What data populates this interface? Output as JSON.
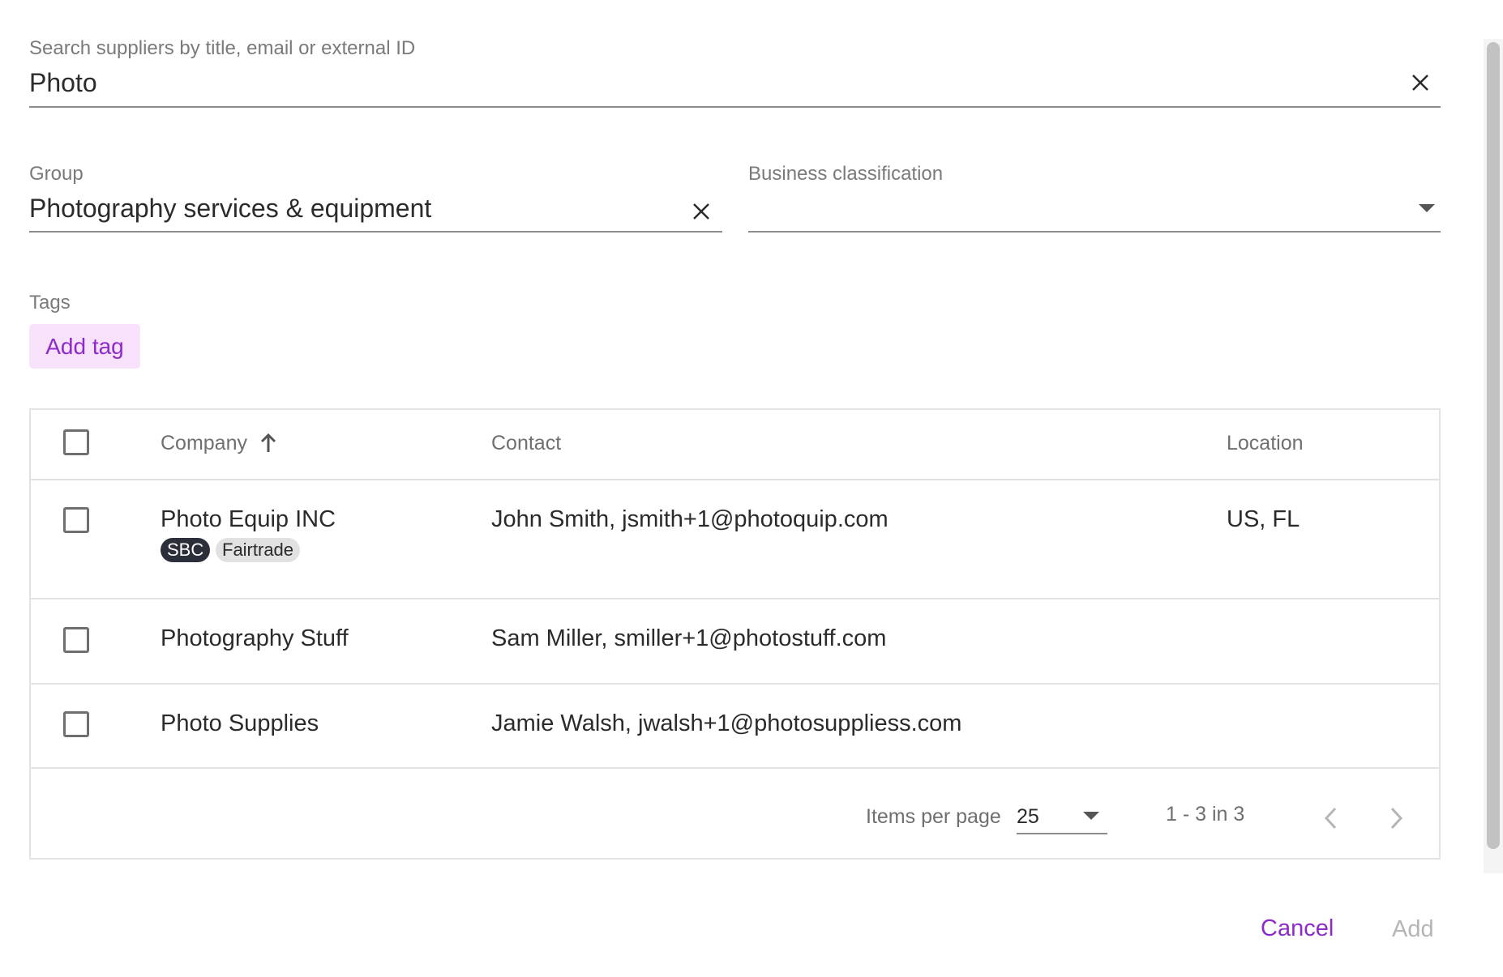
{
  "search": {
    "label": "Search suppliers by title, email or external ID",
    "value": "Photo"
  },
  "group": {
    "label": "Group",
    "value": "Photography services & equipment"
  },
  "business_classification": {
    "label": "Business classification",
    "value": ""
  },
  "tags": {
    "label": "Tags",
    "add_label": "Add tag"
  },
  "table": {
    "headers": {
      "company": "Company",
      "contact": "Contact",
      "location": "Location"
    },
    "rows": [
      {
        "company": "Photo Equip INC",
        "contact": "John Smith, jsmith+1@photoquip.com",
        "location": "US, FL",
        "badges": [
          "SBC",
          "Fairtrade"
        ]
      },
      {
        "company": "Photography Stuff",
        "contact": "Sam Miller, smiller+1@photostuff.com",
        "location": "",
        "badges": []
      },
      {
        "company": "Photo Supplies",
        "contact": "Jamie Walsh, jwalsh+1@photosuppliess.com",
        "location": "",
        "badges": []
      }
    ],
    "pagination": {
      "items_per_page_label": "Items per page",
      "items_per_page_value": "25",
      "range": "1 - 3 in 3"
    }
  },
  "actions": {
    "cancel": "Cancel",
    "add": "Add"
  },
  "colors": {
    "accent": "#8e2ac9",
    "tag_bg": "#f7e1fb",
    "badge_dark": "#2b2f3a",
    "disabled": "#b5b5b5"
  }
}
